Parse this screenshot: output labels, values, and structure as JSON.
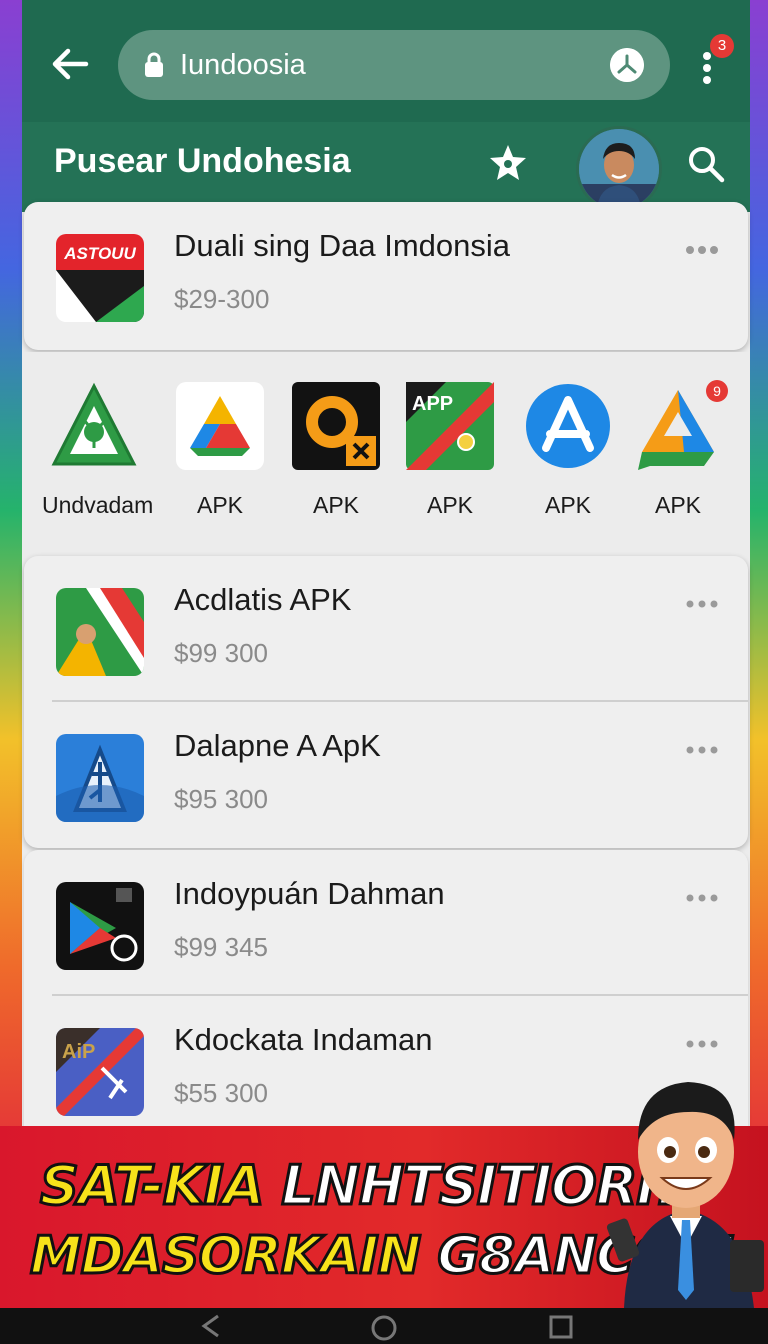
{
  "browser": {
    "url_text": "Iundoosia",
    "notification_count": "3"
  },
  "header": {
    "title": "Pusear Undohesia"
  },
  "featured": {
    "name": "Duali sing Daa Imdonsia",
    "price": "$29-300",
    "icon_text": "ASTOUU"
  },
  "apk_grid": {
    "items": [
      {
        "label": "Undvadam",
        "icon": "green-a-app-icon"
      },
      {
        "label": "APK",
        "icon": "drive-triangle-icon"
      },
      {
        "label": "APK",
        "icon": "orange-ring-icon"
      },
      {
        "label": "APK",
        "icon": "app-stripe-icon",
        "icon_text": "APP"
      },
      {
        "label": "APK",
        "icon": "app-store-icon"
      },
      {
        "label": "APK",
        "icon": "drive-chat-icon",
        "badge": "9"
      }
    ]
  },
  "list": [
    {
      "name": "Acdlatis APK",
      "price": "$99 300"
    },
    {
      "name": "Dalapne A ApK",
      "price": "$95 300"
    },
    {
      "name": "Indoypuán Dahman",
      "price": "$99 345"
    },
    {
      "name": "Kdockata Indaman",
      "price": "$55 300",
      "icon_text": "AiP"
    }
  ],
  "banner": {
    "line1_yellow": "SAT-KIA",
    "line1_white": "LNHTSITIORI!",
    "line2_yellow": "MDASORKAIN",
    "line2_white_a": "G8A",
    "line2_white_b": "NCOS!"
  },
  "colors": {
    "browser_bar": "#1f6a50",
    "header_bar": "#247256",
    "banner_red": "#d9172c",
    "banner_yellow": "#f7e21a"
  }
}
